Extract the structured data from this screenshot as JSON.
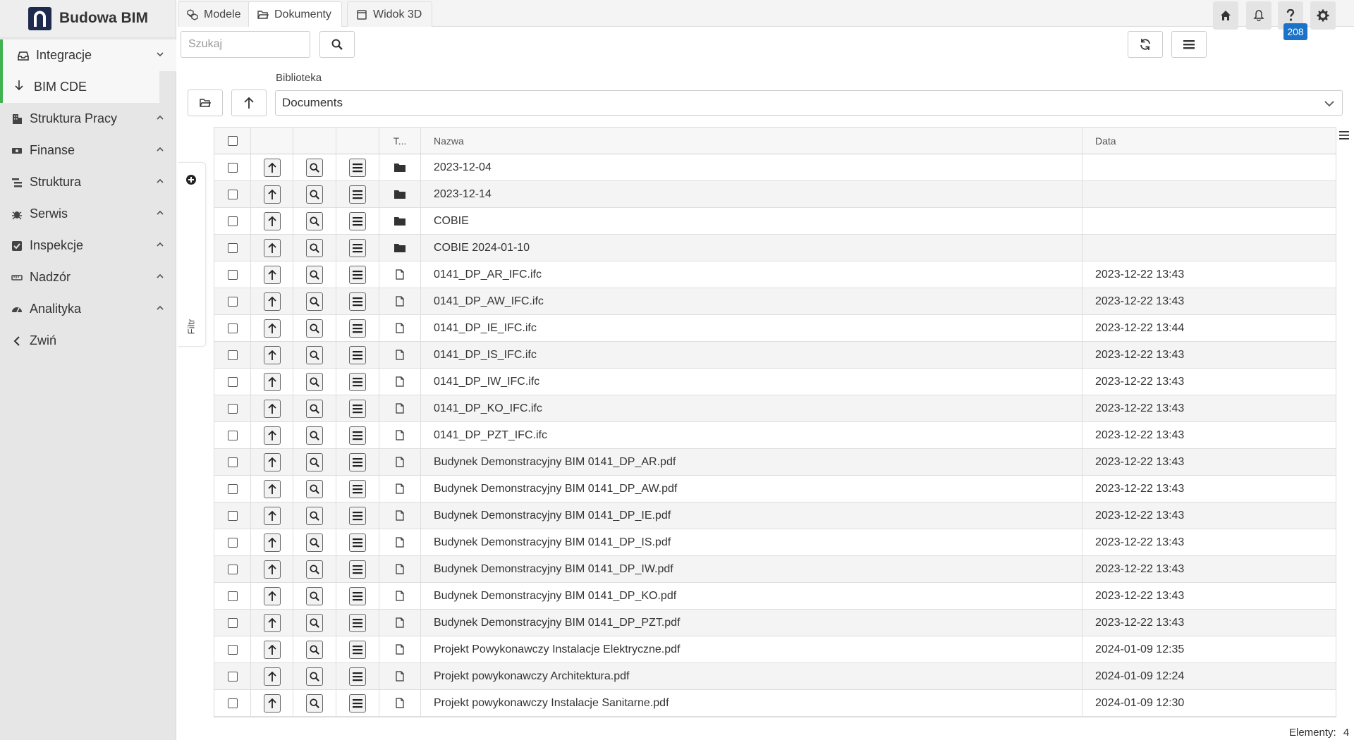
{
  "app": {
    "title": "Budowa BIM"
  },
  "sidebar": {
    "items": [
      {
        "label": "Integracje",
        "icon": "inbox-icon",
        "active": true
      },
      {
        "label": "BIM CDE",
        "icon": "arrow-down-icon",
        "sub": true
      },
      {
        "label": "Struktura Pracy",
        "icon": "building-icon"
      },
      {
        "label": "Finanse",
        "icon": "money-icon"
      },
      {
        "label": "Struktura",
        "icon": "list-tree-icon"
      },
      {
        "label": "Serwis",
        "icon": "bug-icon"
      },
      {
        "label": "Inspekcje",
        "icon": "check-square-icon"
      },
      {
        "label": "Nadzór",
        "icon": "ruler-icon"
      },
      {
        "label": "Analityka",
        "icon": "gauge-icon"
      },
      {
        "label": "Zwiń",
        "icon": "chevron-left-icon"
      }
    ]
  },
  "tabs": [
    {
      "label": "Modele",
      "icon": "cubes-icon"
    },
    {
      "label": "Dokumenty",
      "icon": "folder-open-icon",
      "active": true
    },
    {
      "label": "Widok 3D",
      "icon": "square-icon"
    }
  ],
  "topbar": {
    "badge": "208"
  },
  "toolbar": {
    "search_placeholder": "Szukaj"
  },
  "library": {
    "label": "Biblioteka",
    "value": "Documents"
  },
  "filter": {
    "label": "Filtr"
  },
  "grid": {
    "columns": {
      "type": "T...",
      "name": "Nazwa",
      "date": "Data"
    },
    "rows": [
      {
        "type": "folder",
        "name": "2023-12-04",
        "date": ""
      },
      {
        "type": "folder",
        "name": "2023-12-14",
        "date": ""
      },
      {
        "type": "folder",
        "name": "COBIE",
        "date": ""
      },
      {
        "type": "folder",
        "name": "COBIE 2024-01-10",
        "date": ""
      },
      {
        "type": "file",
        "name": "0141_DP_AR_IFC.ifc",
        "date": "2023-12-22 13:43"
      },
      {
        "type": "file",
        "name": "0141_DP_AW_IFC.ifc",
        "date": "2023-12-22 13:43"
      },
      {
        "type": "file",
        "name": "0141_DP_IE_IFC.ifc",
        "date": "2023-12-22 13:44"
      },
      {
        "type": "file",
        "name": "0141_DP_IS_IFC.ifc",
        "date": "2023-12-22 13:43"
      },
      {
        "type": "file",
        "name": "0141_DP_IW_IFC.ifc",
        "date": "2023-12-22 13:43"
      },
      {
        "type": "file",
        "name": "0141_DP_KO_IFC.ifc",
        "date": "2023-12-22 13:43"
      },
      {
        "type": "file",
        "name": "0141_DP_PZT_IFC.ifc",
        "date": "2023-12-22 13:43"
      },
      {
        "type": "file",
        "name": "Budynek Demonstracyjny BIM 0141_DP_AR.pdf",
        "date": "2023-12-22 13:43"
      },
      {
        "type": "file",
        "name": "Budynek Demonstracyjny BIM 0141_DP_AW.pdf",
        "date": "2023-12-22 13:43"
      },
      {
        "type": "file",
        "name": "Budynek Demonstracyjny BIM 0141_DP_IE.pdf",
        "date": "2023-12-22 13:43"
      },
      {
        "type": "file",
        "name": "Budynek Demonstracyjny BIM 0141_DP_IS.pdf",
        "date": "2023-12-22 13:43"
      },
      {
        "type": "file",
        "name": "Budynek Demonstracyjny BIM 0141_DP_IW.pdf",
        "date": "2023-12-22 13:43"
      },
      {
        "type": "file",
        "name": "Budynek Demonstracyjny BIM 0141_DP_KO.pdf",
        "date": "2023-12-22 13:43"
      },
      {
        "type": "file",
        "name": "Budynek Demonstracyjny BIM 0141_DP_PZT.pdf",
        "date": "2023-12-22 13:43"
      },
      {
        "type": "file",
        "name": "Projekt Powykonawczy Instalacje Elektryczne.pdf",
        "date": "2024-01-09 12:35"
      },
      {
        "type": "file",
        "name": "Projekt powykonawczy Architektura.pdf",
        "date": "2024-01-09 12:24"
      },
      {
        "type": "file",
        "name": "Projekt powykonawczy Instalacje Sanitarne.pdf",
        "date": "2024-01-09 12:30"
      }
    ]
  },
  "footer": {
    "label": "Elementy:",
    "count": "4"
  },
  "colors": {
    "accent_green": "#3eb34f",
    "badge_blue": "#1a73c8",
    "logo_navy": "#1f2a4f"
  }
}
